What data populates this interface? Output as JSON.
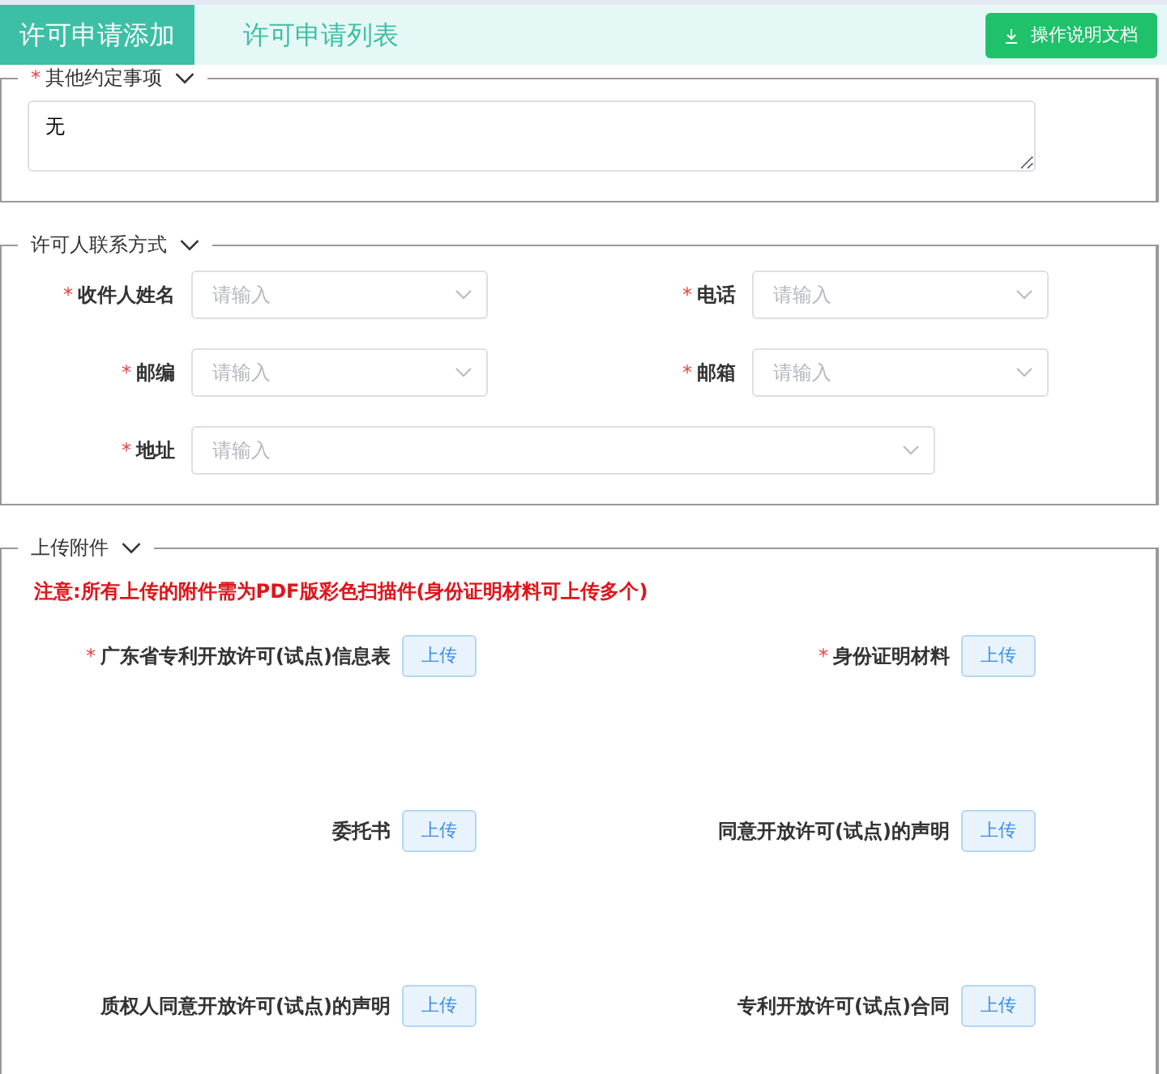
{
  "tabs": [
    {
      "label": "许可申请添加",
      "selected": true
    },
    {
      "label": "许可申请列表",
      "selected": false
    }
  ],
  "doc_button": "操作说明文档",
  "other_terms": {
    "title": "其他约定事项",
    "mark": "*",
    "value": "无"
  },
  "contact": {
    "title": "许可人联系方式",
    "fields": [
      {
        "label": "收件人姓名",
        "mark": "*",
        "placeholder": "请输入"
      },
      {
        "label": "电话",
        "mark": "*",
        "placeholder": "请输入"
      },
      {
        "label": "邮编",
        "mark": "*",
        "placeholder": "请输入"
      },
      {
        "label": "邮箱",
        "mark": "*",
        "placeholder": "请输入"
      },
      {
        "label": "地址",
        "mark": "*",
        "placeholder": "请输入"
      }
    ]
  },
  "attachments": {
    "title": "上传附件",
    "notice": "注意:所有上传的附件需为PDF版彩色扫描件(身份证明材料可上传多个)",
    "items": [
      {
        "label": "广东省专利开放许可(试点)信息表",
        "mark": "*",
        "button": "上传"
      },
      {
        "label": "身份证明材料",
        "mark": "*",
        "button": "上传"
      },
      {
        "label": "委托书",
        "button": "上传"
      },
      {
        "label": "同意开放许可(试点)的声明",
        "button": "上传"
      },
      {
        "label": "质权人同意开放许可(试点)的声明",
        "button": "上传"
      },
      {
        "label": "专利开放许可(试点)合同",
        "button": "上传"
      }
    ]
  }
}
